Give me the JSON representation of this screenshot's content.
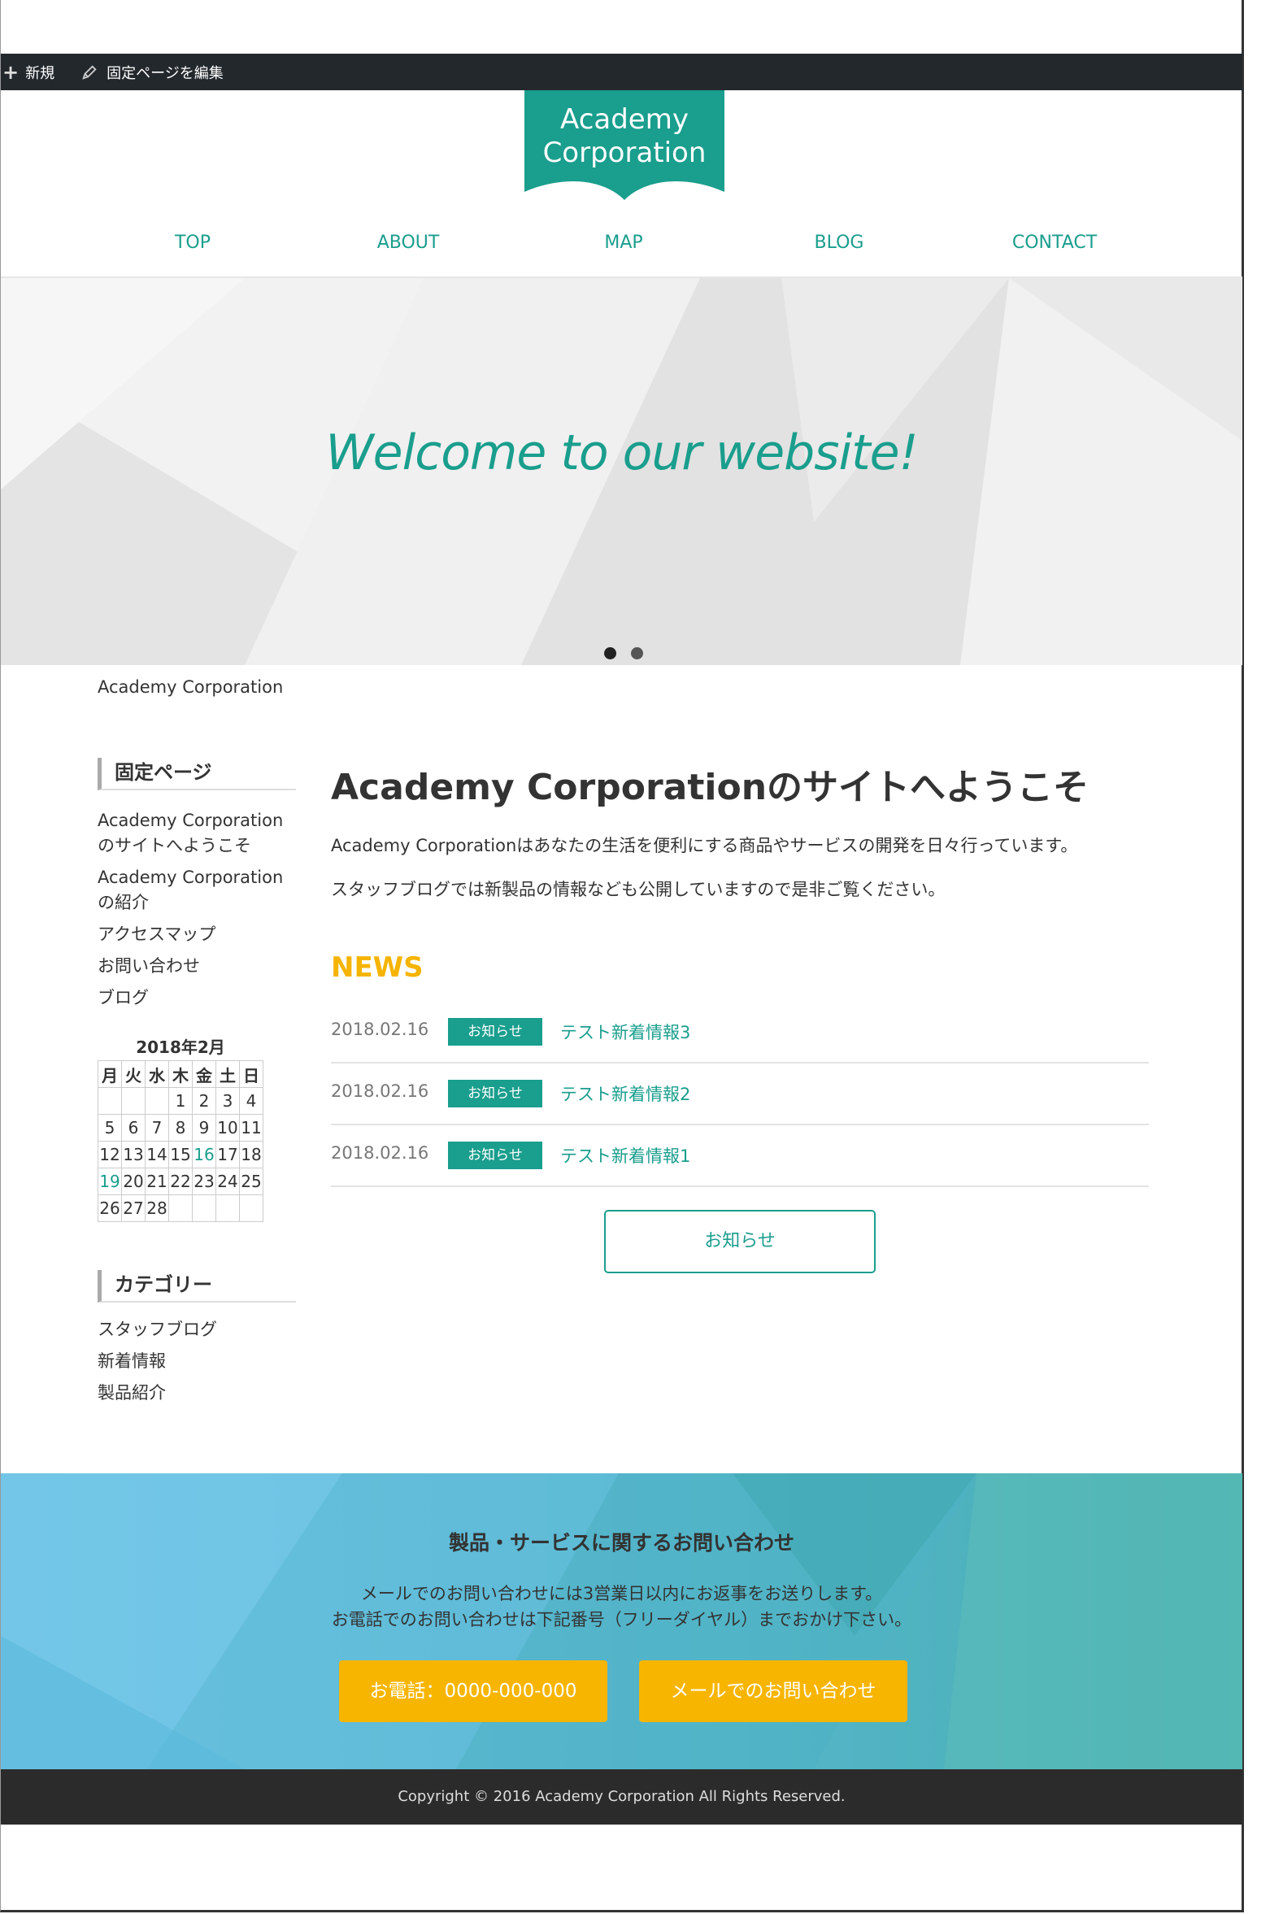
{
  "admin_bar": {
    "new_label": "新規",
    "edit_label": "固定ページを編集"
  },
  "header": {
    "logo_line1": "Academy",
    "logo_line2": "Corporation",
    "nav": [
      "TOP",
      "ABOUT",
      "MAP",
      "BLOG",
      "CONTACT"
    ],
    "accent_color": "#1a9e8d"
  },
  "hero": {
    "title": "Welcome to our website!",
    "slide_count": 2,
    "active_slide": 1
  },
  "breadcrumb": "Academy Corporation",
  "sidebar": {
    "pages_title": "固定ページ",
    "pages": [
      {
        "line1": "Academy Corporation",
        "line2": "のサイトへようこそ"
      },
      {
        "line1": "Academy Corporation",
        "line2": "の紹介"
      },
      {
        "line1": "アクセスマップ"
      },
      {
        "line1": "お問い合わせ"
      },
      {
        "line1": "ブログ"
      }
    ],
    "calendar": {
      "caption": "2018年2月",
      "weekdays": [
        "月",
        "火",
        "水",
        "木",
        "金",
        "土",
        "日"
      ],
      "rows": [
        [
          "",
          "",
          "",
          "1",
          "2",
          "3",
          "4"
        ],
        [
          "5",
          "6",
          "7",
          "8",
          "9",
          "10",
          "11"
        ],
        [
          "12",
          "13",
          "14",
          "15",
          "16",
          "17",
          "18"
        ],
        [
          "19",
          "20",
          "21",
          "22",
          "23",
          "24",
          "25"
        ],
        [
          "26",
          "27",
          "28",
          "",
          "",
          "",
          ""
        ]
      ],
      "linked_days": [
        "16",
        "19"
      ]
    },
    "categories_title": "カテゴリー",
    "categories": [
      "スタッフブログ",
      "新着情報",
      "製品紹介"
    ]
  },
  "main": {
    "title": "Academy Corporationのサイトへようこそ",
    "paragraph1": "Academy Corporationはあなたの生活を便利にする商品やサービスの開発を日々行っています。",
    "paragraph2": "スタッフブログでは新製品の情報なども公開していますので是非ご覧ください。",
    "news_heading": "NEWS",
    "news": [
      {
        "date": "2018.02.16",
        "badge": "お知らせ",
        "title": "テスト新着情報3"
      },
      {
        "date": "2018.02.16",
        "badge": "お知らせ",
        "title": "テスト新着情報2"
      },
      {
        "date": "2018.02.16",
        "badge": "お知らせ",
        "title": "テスト新着情報1"
      }
    ],
    "news_button": "お知らせ"
  },
  "contact": {
    "title": "製品・サービスに関するお問い合わせ",
    "line1": "メールでのお問い合わせには3営業日以内にお返事をお送りします。",
    "line2": "お電話でのお問い合わせは下記番号（フリーダイヤル）までおかけ下さい。",
    "phone_button": "お電話：0000-000-000",
    "mail_button": "メールでのお問い合わせ",
    "button_color": "#f8b500"
  },
  "footer": {
    "copyright": "Copyright © 2016 Academy Corporation All Rights Reserved."
  }
}
